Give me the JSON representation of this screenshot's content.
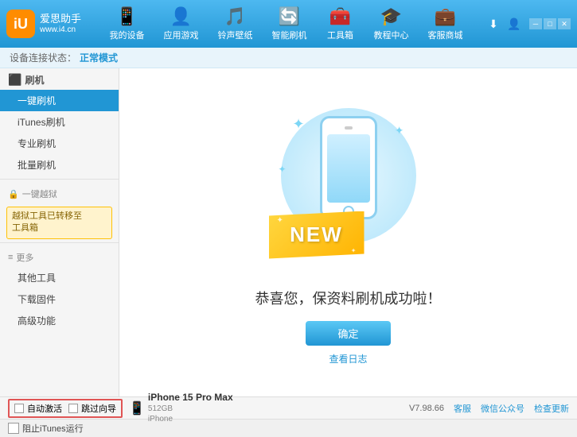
{
  "app": {
    "logo_icon": "iU",
    "logo_name": "爱思助手",
    "logo_sub": "www.i4.cn",
    "title": "爱思助手"
  },
  "nav": {
    "items": [
      {
        "id": "my-device",
        "icon": "📱",
        "label": "我的设备"
      },
      {
        "id": "apps-games",
        "icon": "👤",
        "label": "应用游戏"
      },
      {
        "id": "ringtones",
        "icon": "🎵",
        "label": "铃声壁纸"
      },
      {
        "id": "smart-flash",
        "icon": "🔄",
        "label": "智能刷机"
      },
      {
        "id": "toolbox",
        "icon": "🧰",
        "label": "工具箱"
      },
      {
        "id": "tutorial",
        "icon": "🎓",
        "label": "教程中心"
      },
      {
        "id": "service",
        "icon": "💼",
        "label": "客服商城"
      }
    ]
  },
  "win_controls": [
    "最小化",
    "最大化",
    "关闭"
  ],
  "status": {
    "prefix": "设备连接状态：",
    "mode": "正常模式"
  },
  "sidebar": {
    "section_flash": "刷机",
    "items": [
      {
        "id": "one-click-flash",
        "label": "一键刷机",
        "active": true
      },
      {
        "id": "itunes-flash",
        "label": "iTunes刷机",
        "active": false
      },
      {
        "id": "pro-flash",
        "label": "专业刷机",
        "active": false
      },
      {
        "id": "batch-flash",
        "label": "批量刷机",
        "active": false
      }
    ],
    "section_jailbreak": "一键越狱",
    "jailbreak_notice": "越狱工具已转移至\n工具箱",
    "section_more": "更多",
    "more_items": [
      {
        "id": "other-tools",
        "label": "其他工具"
      },
      {
        "id": "download-firmware",
        "label": "下载固件"
      },
      {
        "id": "advanced",
        "label": "高级功能"
      }
    ]
  },
  "content": {
    "success_title": "恭喜您，保资料刷机成功啦！",
    "new_badge": "NEW",
    "confirm_btn": "确定",
    "log_link": "查看日志"
  },
  "bottom": {
    "auto_activate_label": "自动激活",
    "guide_label": "跳过向导",
    "device_name": "iPhone 15 Pro Max",
    "device_storage": "512GB",
    "device_type": "iPhone",
    "version": "V7.98.66",
    "tab1": "客服",
    "tab2": "微信公众号",
    "tab3": "检查更新"
  },
  "itunes_bar": {
    "checkbox_label": "阻止iTunes运行"
  }
}
